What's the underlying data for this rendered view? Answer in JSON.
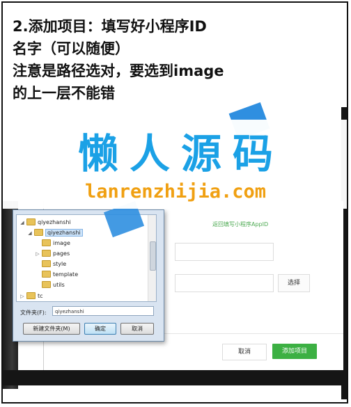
{
  "instructions": {
    "line1": "2.添加项目：填写好小程序ID",
    "line2": "名字（可以随便）",
    "line3": "注意是路径选对，要选到image",
    "line4": "的上一层不能错"
  },
  "watermark": {
    "title": "懒人源码",
    "url": "lanrenzhijia.com",
    "color_title": "#1ba1e6",
    "color_url": "#f0a012"
  },
  "app": {
    "hint": "返回填写小程序AppID",
    "choose_label": "选择",
    "cancel_label": "取消",
    "add_label": "添加项目",
    "accent": "#3cb043"
  },
  "dialog": {
    "tree": [
      {
        "label": "qiyezhanshi",
        "depth": 1,
        "expand": "◢"
      },
      {
        "label": "qiyezhanshi",
        "depth": 2,
        "expand": "◢",
        "selected": true
      },
      {
        "label": "image",
        "depth": 3,
        "expand": ""
      },
      {
        "label": "pages",
        "depth": 3,
        "expand": "▷"
      },
      {
        "label": "style",
        "depth": 3,
        "expand": ""
      },
      {
        "label": "template",
        "depth": 3,
        "expand": ""
      },
      {
        "label": "utils",
        "depth": 3,
        "expand": ""
      },
      {
        "label": "tc",
        "depth": 1,
        "expand": "▷"
      }
    ],
    "folder_label": "文件夹(F):",
    "folder_value": "qiyezhanshi",
    "new_folder_label": "新建文件夹(M)",
    "ok_label": "确定",
    "cancel_label": "取消"
  }
}
